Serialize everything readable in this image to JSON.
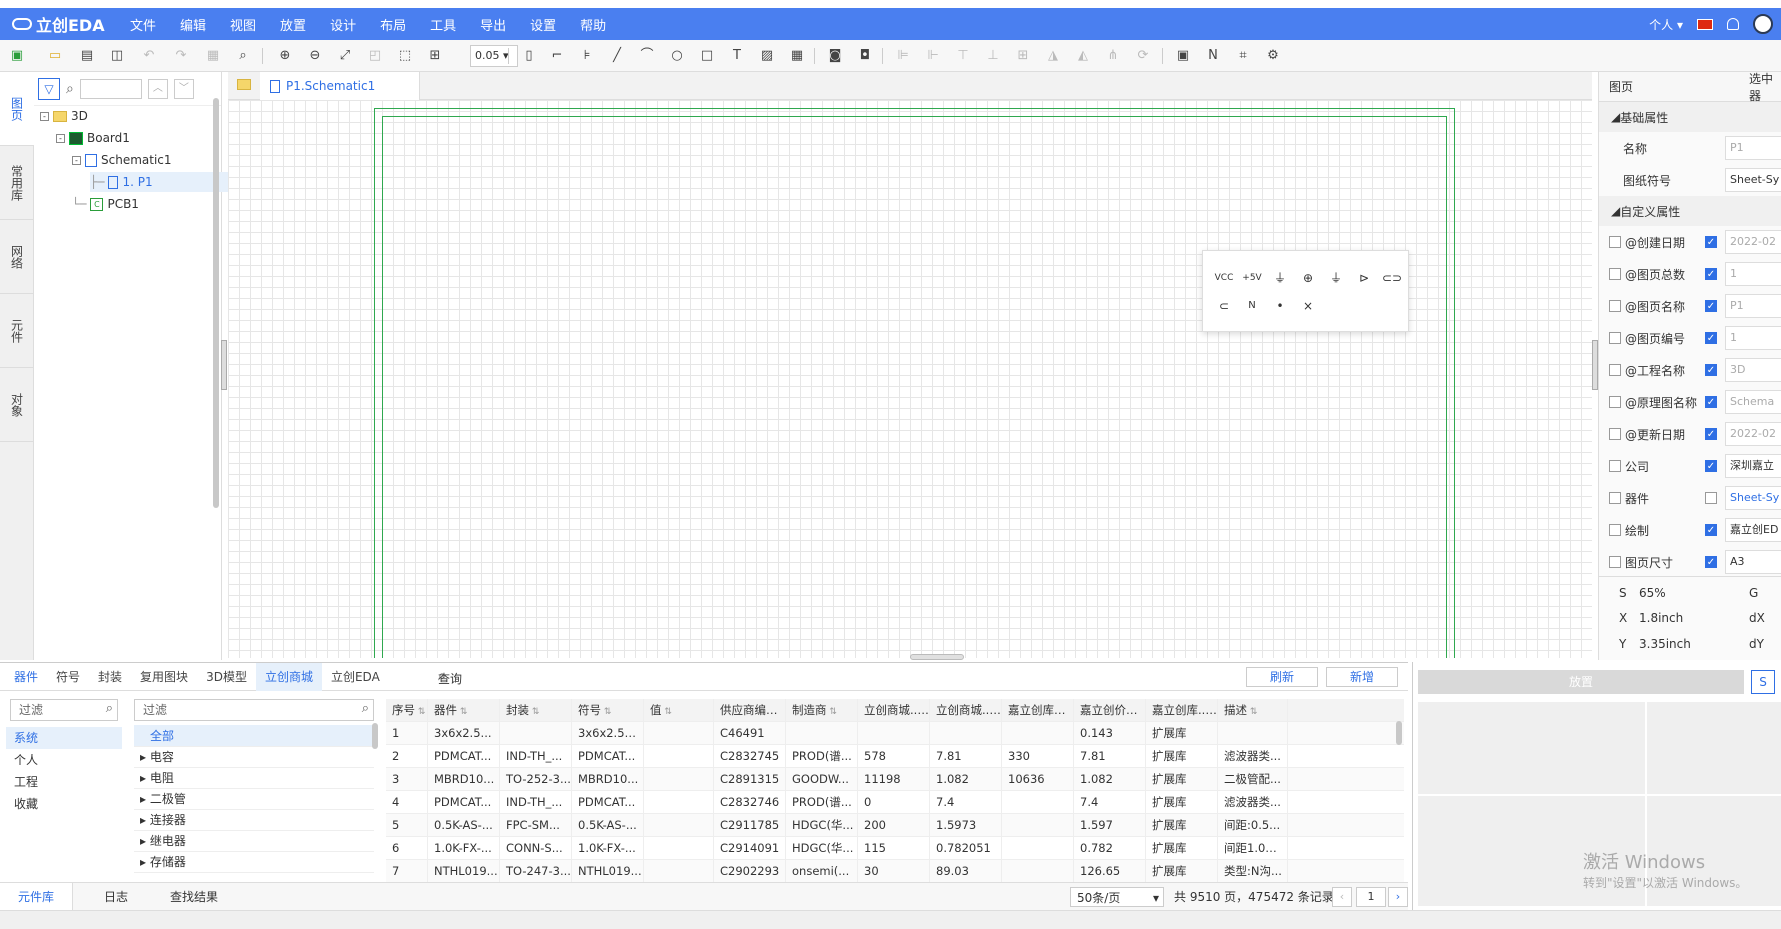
{
  "app": {
    "logo": "立创EDA"
  },
  "menu": [
    "文件",
    "编辑",
    "视图",
    "放置",
    "设计",
    "布局",
    "工具",
    "导出",
    "设置",
    "帮助"
  ],
  "menubar_right": {
    "personal": "个人"
  },
  "toolbar": {
    "zoom": "0.05"
  },
  "vtabs": [
    "图页",
    "常用库",
    "网络",
    "元件",
    "对象"
  ],
  "tree": {
    "root": "3D",
    "board": "Board1",
    "schematic": "Schematic1",
    "page": "1. P1",
    "pcb": "PCB1"
  },
  "editor": {
    "tab": "P1.Schematic1"
  },
  "quick_palette": [
    "VCC",
    "+5V",
    "⏚",
    "⊕",
    "⏚",
    "⊳",
    "⊂⊃",
    "⊂",
    "N",
    "•",
    "×"
  ],
  "props": {
    "header_left": "图页",
    "header_right": "选中器",
    "basic_section": "基础属性",
    "name_label": "名称",
    "name_value": "P1",
    "sheet_label": "图纸符号",
    "sheet_value": "Sheet-Sy",
    "custom_section": "自定义属性",
    "rows": [
      {
        "label": "@创建日期",
        "checked": true,
        "value": "2022-02"
      },
      {
        "label": "@图页总数",
        "checked": true,
        "value": "1"
      },
      {
        "label": "@图页名称",
        "checked": true,
        "value": "P1"
      },
      {
        "label": "@图页编号",
        "checked": true,
        "value": "1"
      },
      {
        "label": "@工程名称",
        "checked": true,
        "value": "3D"
      },
      {
        "label": "@原理图名称",
        "checked": true,
        "value": "Schema"
      },
      {
        "label": "@更新日期",
        "checked": true,
        "value": "2022-02"
      },
      {
        "label": "公司",
        "checked": true,
        "value": "深圳嘉立"
      },
      {
        "label": "器件",
        "checked": false,
        "value": "Sheet-Sy"
      },
      {
        "label": "绘制",
        "checked": true,
        "value": "嘉立创ED"
      },
      {
        "label": "图页尺寸",
        "checked": true,
        "value": "A3"
      }
    ],
    "status": {
      "s_label": "S",
      "s_value": "65%",
      "g_label": "G",
      "x_label": "X",
      "x_value": "1.8inch",
      "dx_label": "dX",
      "y_label": "Y",
      "y_value": "3.35inch",
      "dy_label": "dY"
    }
  },
  "bottom": {
    "tabs": [
      "器件",
      "符号",
      "封装",
      "复用图块",
      "3D模型",
      "立创商城",
      "立创EDA"
    ],
    "query_label": "查询",
    "refresh": "刷新",
    "add": "新增",
    "filter_placeholder": "过滤",
    "categories": [
      "系统",
      "个人",
      "工程",
      "收藏"
    ],
    "tree": [
      "全部",
      "电容",
      "电阻",
      "二极管",
      "连接器",
      "继电器",
      "存储器"
    ],
    "columns": [
      "序号",
      "器件",
      "封装",
      "符号",
      "值",
      "供应商编号",
      "制造商",
      "立创商城...",
      "立创商城...",
      "嘉立创库存",
      "嘉立创价格",
      "嘉立创库...",
      "描述"
    ],
    "rows": [
      [
        "1",
        "3x6x2.5...",
        "",
        "3x6x2.5R...",
        "",
        "C46491",
        "",
        "",
        "",
        "",
        "0.143",
        "扩展库",
        ""
      ],
      [
        "2",
        "PDMCAT...",
        "IND-TH_...",
        "PDMCAT...",
        "",
        "C2832745",
        "PROD(谱...",
        "578",
        "7.81",
        "330",
        "7.81",
        "扩展库",
        "滤波器类..."
      ],
      [
        "3",
        "MBRD10...",
        "TO-252-3...",
        "MBRD10...",
        "",
        "C2891315",
        "GOODW...",
        "11198",
        "1.082",
        "10636",
        "1.082",
        "扩展库",
        "二极管配..."
      ],
      [
        "4",
        "PDMCAT...",
        "IND-TH_...",
        "PDMCAT...",
        "",
        "C2832746",
        "PROD(谱...",
        "0",
        "7.4",
        "",
        "7.4",
        "扩展库",
        "滤波器类..."
      ],
      [
        "5",
        "0.5K-AS-...",
        "FPC-SM...",
        "0.5K-AS-...",
        "",
        "C2911785",
        "HDGC(华...",
        "200",
        "1.5973",
        "",
        "1.597",
        "扩展库",
        "间距:0.5..."
      ],
      [
        "6",
        "1.0K-FX-...",
        "CONN-S...",
        "1.0K-FX-...",
        "",
        "C2914091",
        "HDGC(华...",
        "115",
        "0.782051",
        "",
        "0.782",
        "扩展库",
        "间距1.0m..."
      ],
      [
        "7",
        "NTHL019...",
        "TO-247-3...",
        "NTHL019...",
        "",
        "C2902293",
        "onsemi(...",
        "30",
        "89.03",
        "",
        "126.65",
        "扩展库",
        "类型:N沟..."
      ]
    ],
    "footer_tabs": [
      "元件库",
      "日志",
      "查找结果"
    ],
    "page_size": "50条/页",
    "summary": "共 9510 页，475472 条记录",
    "page_num": "1"
  },
  "preview": {
    "place": "放置",
    "s_btn": "S"
  },
  "watermark": {
    "line1": "激活 Windows",
    "line2": "转到\"设置\"以激活 Windows。"
  },
  "colors": {
    "accent": "#4a7ff0",
    "link": "#2f6fe4",
    "frame": "#2fa84f"
  }
}
